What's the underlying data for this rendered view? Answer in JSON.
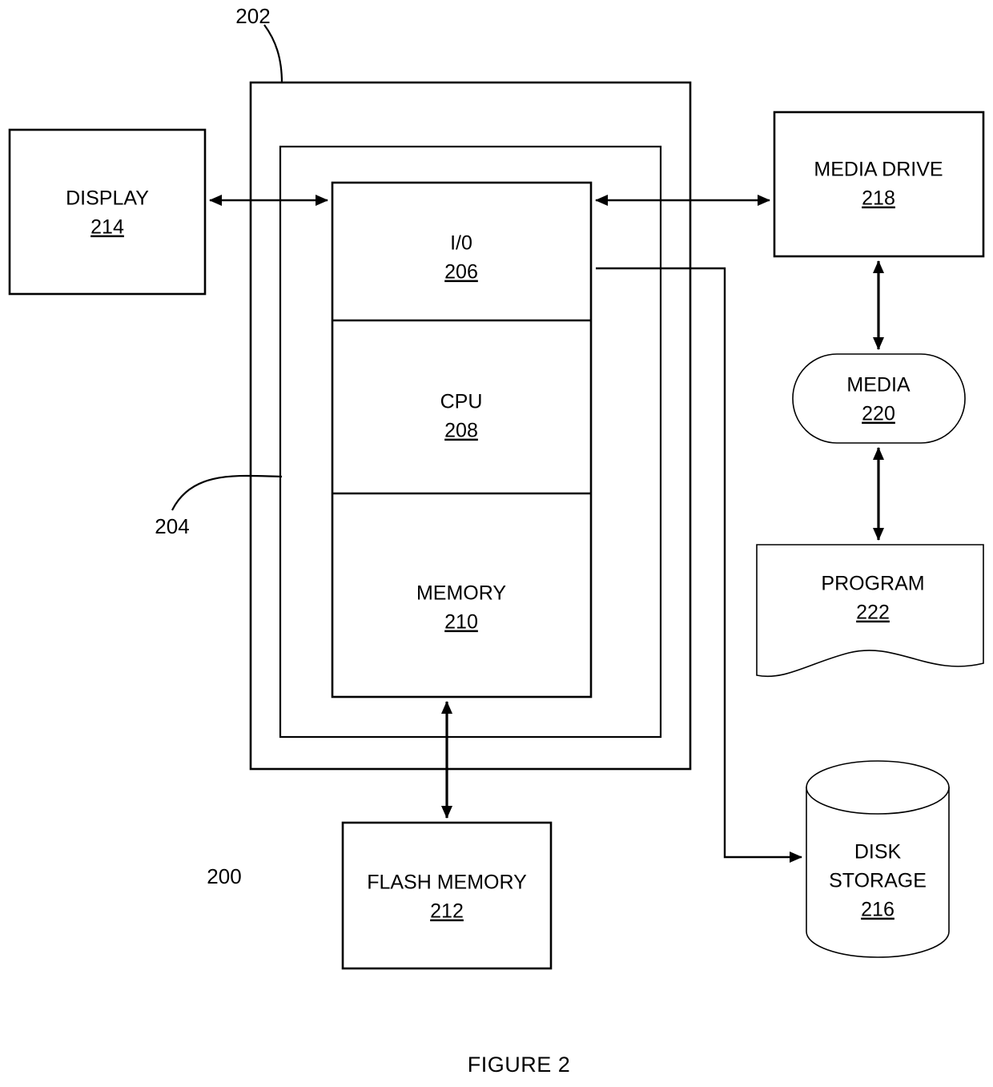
{
  "figure": {
    "caption": "FIGURE 2",
    "system_ref": "200",
    "outer_enclosure_ref": "202",
    "inner_enclosure_ref": "204"
  },
  "blocks": {
    "io": {
      "label": "I/0",
      "ref": "206"
    },
    "cpu": {
      "label": "CPU",
      "ref": "208"
    },
    "memory": {
      "label": "MEMORY",
      "ref": "210"
    },
    "flash_memory": {
      "label": "FLASH MEMORY",
      "ref": "212"
    },
    "display": {
      "label": "DISPLAY",
      "ref": "214"
    },
    "disk_storage": {
      "label_line1": "DISK",
      "label_line2": "STORAGE",
      "ref": "216"
    },
    "media_drive": {
      "label": "MEDIA DRIVE",
      "ref": "218"
    },
    "media": {
      "label": "MEDIA",
      "ref": "220"
    },
    "program": {
      "label": "PROGRAM",
      "ref": "222"
    }
  },
  "colors": {
    "stroke": "#000000",
    "fill": "#ffffff",
    "text": "#000000"
  }
}
